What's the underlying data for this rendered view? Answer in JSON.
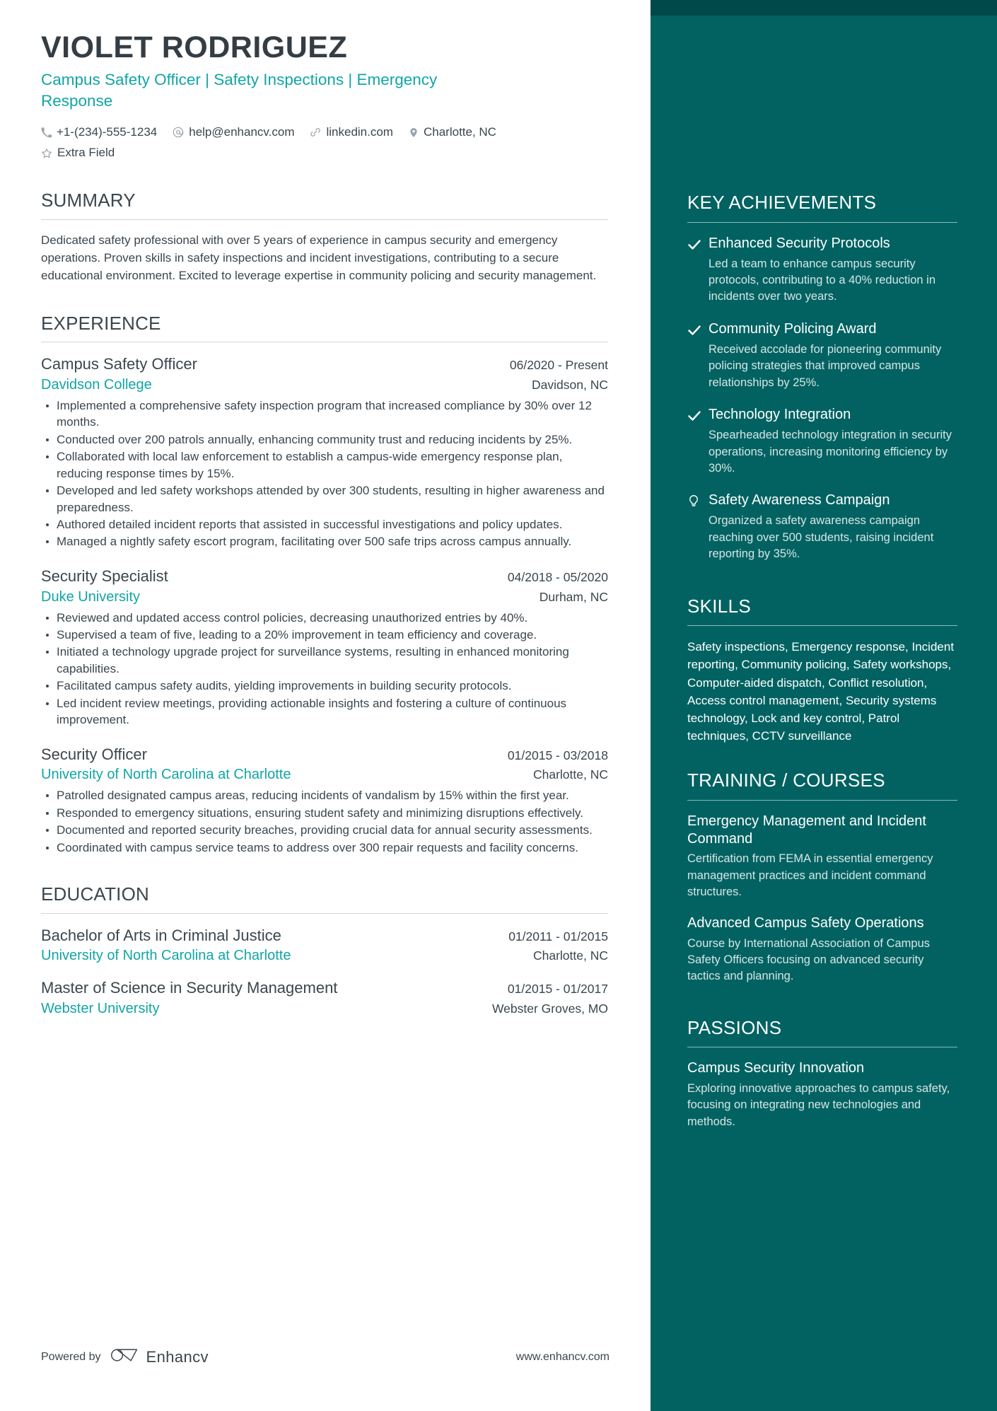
{
  "header": {
    "name": "VIOLET RODRIGUEZ",
    "headline": "Campus Safety Officer | Safety Inspections | Emergency Response",
    "contacts": [
      {
        "icon": "phone-icon",
        "text": "+1-(234)-555-1234"
      },
      {
        "icon": "email-icon",
        "text": "help@enhancv.com"
      },
      {
        "icon": "link-icon",
        "text": "linkedin.com"
      },
      {
        "icon": "location-pin-icon",
        "text": "Charlotte, NC"
      },
      {
        "icon": "star-icon",
        "text": "Extra Field"
      }
    ]
  },
  "summary": {
    "title": "SUMMARY",
    "text": "Dedicated safety professional with over 5 years of experience in campus security and emergency operations. Proven skills in safety inspections and incident investigations, contributing to a secure educational environment. Excited to leverage expertise in community policing and security management."
  },
  "experience": {
    "title": "EXPERIENCE",
    "jobs": [
      {
        "title": "Campus Safety Officer",
        "dates": "06/2020 - Present",
        "org": "Davidson College",
        "location": "Davidson, NC",
        "bullets": [
          "Implemented a comprehensive safety inspection program that increased compliance by 30% over 12 months.",
          "Conducted over 200 patrols annually, enhancing community trust and reducing incidents by 25%.",
          "Collaborated with local law enforcement to establish a campus-wide emergency response plan, reducing response times by 15%.",
          "Developed and led safety workshops attended by over 300 students, resulting in higher awareness and preparedness.",
          "Authored detailed incident reports that assisted in successful investigations and policy updates.",
          "Managed a nightly safety escort program, facilitating over 500 safe trips across campus annually."
        ]
      },
      {
        "title": "Security Specialist",
        "dates": "04/2018 - 05/2020",
        "org": "Duke University",
        "location": "Durham, NC",
        "bullets": [
          "Reviewed and updated access control policies, decreasing unauthorized entries by 40%.",
          "Supervised a team of five, leading to a 20% improvement in team efficiency and coverage.",
          "Initiated a technology upgrade project for surveillance systems, resulting in enhanced monitoring capabilities.",
          "Facilitated campus safety audits, yielding improvements in building security protocols.",
          "Led incident review meetings, providing actionable insights and fostering a culture of continuous improvement."
        ]
      },
      {
        "title": "Security Officer",
        "dates": "01/2015 - 03/2018",
        "org": "University of North Carolina at Charlotte",
        "location": "Charlotte, NC",
        "bullets": [
          "Patrolled designated campus areas, reducing incidents of vandalism by 15% within the first year.",
          "Responded to emergency situations, ensuring student safety and minimizing disruptions effectively.",
          "Documented and reported security breaches, providing crucial data for annual security assessments.",
          "Coordinated with campus service teams to address over 300 repair requests and facility concerns."
        ]
      }
    ]
  },
  "education": {
    "title": "EDUCATION",
    "items": [
      {
        "degree": "Bachelor of Arts in Criminal Justice",
        "dates": "01/2011 - 01/2015",
        "school": "University of North Carolina at Charlotte",
        "location": "Charlotte, NC"
      },
      {
        "degree": "Master of Science in Security Management",
        "dates": "01/2015 - 01/2017",
        "school": "Webster University",
        "location": "Webster Groves, MO"
      }
    ]
  },
  "achievements": {
    "title": "KEY ACHIEVEMENTS",
    "items": [
      {
        "icon": "check-icon",
        "title": "Enhanced Security Protocols",
        "desc": "Led a team to enhance campus security protocols, contributing to a 40% reduction in incidents over two years."
      },
      {
        "icon": "check-icon",
        "title": "Community Policing Award",
        "desc": "Received accolade for pioneering community policing strategies that improved campus relationships by 25%."
      },
      {
        "icon": "check-icon",
        "title": "Technology Integration",
        "desc": "Spearheaded technology integration in security operations, increasing monitoring efficiency by 30%."
      },
      {
        "icon": "lightbulb-icon",
        "title": "Safety Awareness Campaign",
        "desc": "Organized a safety awareness campaign reaching over 500 students, raising incident reporting by 35%."
      }
    ]
  },
  "skills": {
    "title": "SKILLS",
    "text": "Safety inspections, Emergency response, Incident reporting, Community policing, Safety workshops, Computer-aided dispatch, Conflict resolution, Access control management, Security systems technology, Lock and key control, Patrol techniques, CCTV surveillance"
  },
  "training": {
    "title": "TRAINING / COURSES",
    "items": [
      {
        "title": "Emergency Management and Incident Command",
        "desc": "Certification from FEMA in essential emergency management practices and incident command structures."
      },
      {
        "title": "Advanced Campus Safety Operations",
        "desc": "Course by International Association of Campus Safety Officers focusing on advanced security tactics and planning."
      }
    ]
  },
  "passions": {
    "title": "PASSIONS",
    "items": [
      {
        "title": "Campus Security Innovation",
        "desc": "Exploring innovative approaches to campus safety, focusing on integrating new technologies and methods."
      }
    ]
  },
  "footer": {
    "powered_label": "Powered by",
    "brand_name": "Enhancv",
    "site": "www.enhancv.com"
  },
  "colors": {
    "accent_teal": "#12a5a5",
    "sidebar_bg": "#026262",
    "sidebar_top_strip": "#00484a",
    "text_dark": "#3b464e"
  }
}
